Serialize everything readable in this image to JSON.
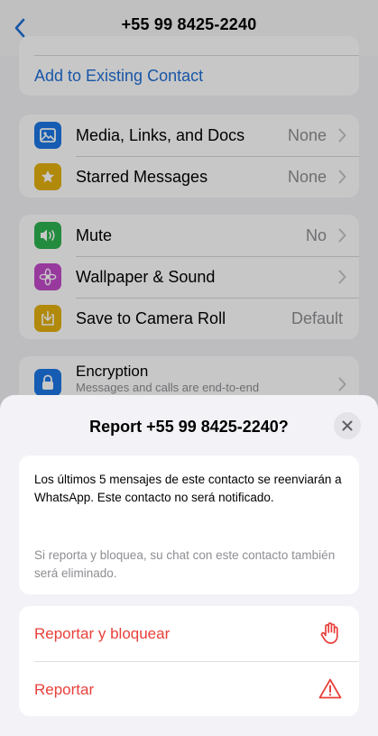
{
  "header": {
    "title": "+55 99 8425-2240",
    "back_icon": "chevron-left-icon"
  },
  "contact_card": {
    "add_existing_label": "Add to Existing Contact"
  },
  "media_section": {
    "items": [
      {
        "label": "Media, Links, and Docs",
        "value": "None",
        "icon": "photo-icon",
        "color": "#1b77e5"
      },
      {
        "label": "Starred Messages",
        "value": "None",
        "icon": "star-icon",
        "color": "#e3b00f"
      }
    ]
  },
  "settings_section": {
    "items": [
      {
        "label": "Mute",
        "value": "No",
        "icon": "speaker-icon",
        "color": "#2eb34f"
      },
      {
        "label": "Wallpaper & Sound",
        "value": "",
        "icon": "flower-icon",
        "color": "#c34bc9"
      },
      {
        "label": "Save to Camera Roll",
        "value": "Default",
        "icon": "download-icon",
        "color": "#e3b00f"
      }
    ]
  },
  "encryption": {
    "label": "Encryption",
    "sublabel": "Messages and calls are end-to-end",
    "icon": "lock-icon",
    "color": "#1b77e5"
  },
  "report_sheet": {
    "title": "Report +55 99 8425-2240?",
    "close_icon": "close-icon",
    "info_text": "Los últimos 5 mensajes de este contacto se reenviarán a WhatsApp. Este contacto no será notificado.",
    "secondary_text": "Si reporta y bloquea, su chat con este contacto también será eliminado.",
    "actions": [
      {
        "label": "Reportar y bloquear",
        "icon": "hand-stop-icon"
      },
      {
        "label": "Reportar",
        "icon": "warning-triangle-icon"
      }
    ],
    "accent_color": "#e8403a"
  }
}
